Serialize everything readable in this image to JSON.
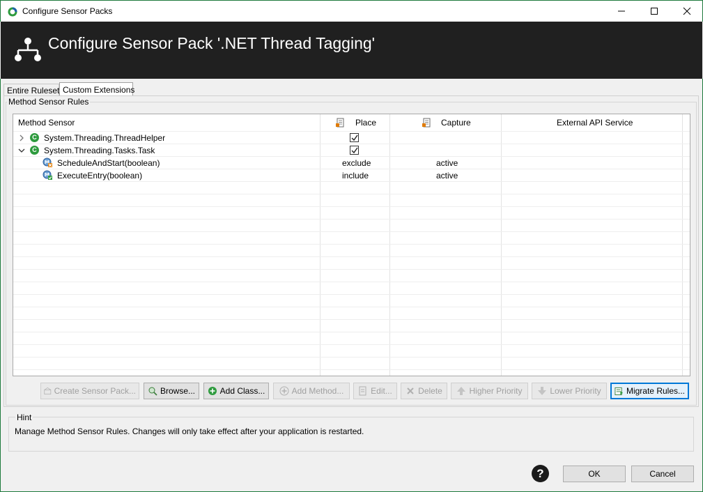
{
  "window": {
    "title": "Configure Sensor Packs",
    "minimize_icon": "minimize-icon",
    "maximize_icon": "maximize-icon",
    "close_icon": "close-icon"
  },
  "banner": {
    "title": "Configure Sensor Pack '.NET Thread Tagging'",
    "icon": "hierarchy-icon"
  },
  "tabs": [
    {
      "label": "Entire Ruleset",
      "selected": false
    },
    {
      "label": "Custom Extensions",
      "selected": true
    }
  ],
  "group": {
    "title": "Method Sensor Rules"
  },
  "table": {
    "columns": [
      {
        "label": "Method Sensor"
      },
      {
        "label": "Place",
        "icon": "document-icon"
      },
      {
        "label": "Capture",
        "icon": "document-icon"
      },
      {
        "label": "External API Service"
      }
    ],
    "rows": [
      {
        "type": "class",
        "name": "System.Threading.ThreadHelper",
        "expanded": false,
        "place_checked": true,
        "place": "",
        "capture": ""
      },
      {
        "type": "class",
        "name": "System.Threading.Tasks.Task",
        "expanded": true,
        "place_checked": true,
        "place": "",
        "capture": ""
      },
      {
        "type": "method",
        "name": "ScheduleAndStart(boolean)",
        "place": "exclude",
        "capture": "active",
        "status": "excluded"
      },
      {
        "type": "method",
        "name": "ExecuteEntry(boolean)",
        "place": "include",
        "capture": "active",
        "status": "included"
      }
    ]
  },
  "buttons": [
    {
      "label": "Create Sensor Pack...",
      "enabled": false,
      "icon": "sensor-pack-icon"
    },
    {
      "label": "Browse...",
      "enabled": true,
      "icon": "browse-icon"
    },
    {
      "label": "Add Class...",
      "enabled": true,
      "icon": "add-class-icon"
    },
    {
      "label": "Add Method...",
      "enabled": false,
      "icon": "add-method-icon"
    },
    {
      "label": "Edit...",
      "enabled": false,
      "icon": "edit-icon"
    },
    {
      "label": "Delete",
      "enabled": false,
      "icon": "delete-icon"
    },
    {
      "label": "Higher Priority",
      "enabled": false,
      "icon": "arrow-up-icon"
    },
    {
      "label": "Lower Priority",
      "enabled": false,
      "icon": "arrow-down-icon"
    },
    {
      "label": "Migrate Rules...",
      "enabled": true,
      "icon": "migrate-icon"
    }
  ],
  "hint": {
    "title": "Hint",
    "text": "Manage Method Sensor Rules. Changes will only take effect after your application is restarted."
  },
  "footer": {
    "help": "?",
    "ok_label": "OK",
    "cancel_label": "Cancel"
  },
  "colors": {
    "window_border": "#1e7a3c",
    "banner_bg": "#202020",
    "class_icon": "#2e9b3e",
    "focus_accent": "#0078d7"
  }
}
